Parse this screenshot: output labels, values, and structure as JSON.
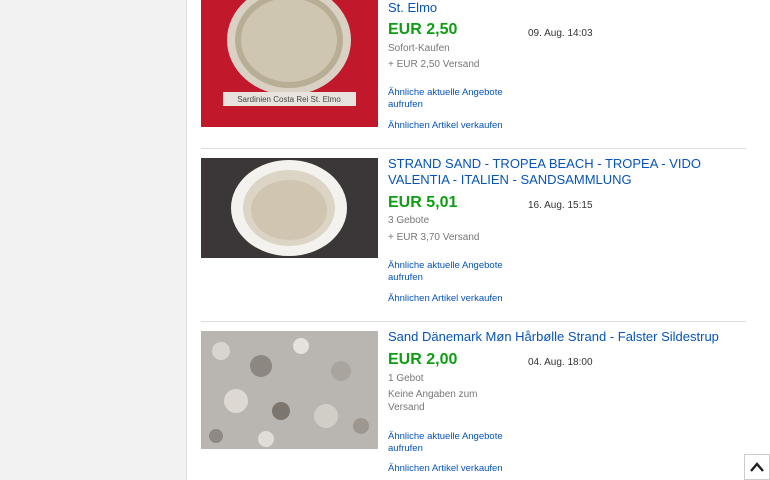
{
  "listings": [
    {
      "title": "St. Elmo",
      "price": "EUR 2,50",
      "format": "Sofort-Kaufen",
      "shipping": "+ EUR 2,50 Versand",
      "date": "09. Aug. 14:03",
      "similar_link": "Ähnliche aktuelle Angebote aufrufen",
      "sell_link": "Ähnlichen Artikel verkaufen",
      "image_caption": "Sardinien  Costa Rei St. Elmo"
    },
    {
      "title": "STRAND SAND - TROPEA BEACH - TROPEA - VIDO VALENTIA - ITALIEN - SANDSAMMLUNG",
      "price": "EUR 5,01",
      "format": "3 Gebote",
      "shipping": "+ EUR 3,70 Versand",
      "date": "16. Aug. 15:15",
      "similar_link": "Ähnliche aktuelle Angebote aufrufen",
      "sell_link": "Ähnlichen Artikel verkaufen"
    },
    {
      "title": "Sand Dänemark Møn Hårbølle Strand - Falster Sildestrup",
      "price": "EUR 2,00",
      "format": "1 Gebot",
      "shipping": "Keine Angaben zum Versand",
      "date": "04. Aug. 18:00",
      "similar_link": "Ähnliche aktuelle Angebote aufrufen",
      "sell_link": "Ähnlichen Artikel verkaufen"
    }
  ],
  "icons": {
    "scroll_top": "chevron-up-icon"
  },
  "colors": {
    "link": "#0654ba",
    "price": "#0e9e13"
  }
}
